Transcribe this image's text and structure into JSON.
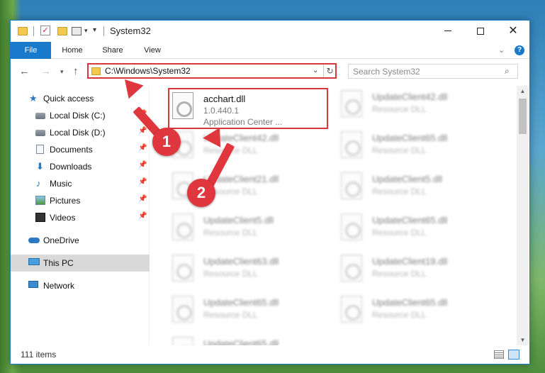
{
  "window": {
    "title": "System32",
    "controls": {
      "minimize": "",
      "maximize": "",
      "close": "✕"
    }
  },
  "ribbon": {
    "tabs": [
      "File",
      "Home",
      "Share",
      "View"
    ],
    "help": "?"
  },
  "navigation": {
    "address": "C:\\Windows\\System32",
    "search_placeholder": "Search System32"
  },
  "sidebar": {
    "items": [
      {
        "label": "Quick access",
        "icon": "star-icon",
        "pinned": false
      },
      {
        "label": "Local Disk (C:)",
        "icon": "disk-icon",
        "pinned": true
      },
      {
        "label": "Local Disk (D:)",
        "icon": "disk-icon",
        "pinned": true
      },
      {
        "label": "Documents",
        "icon": "documents-icon",
        "pinned": true
      },
      {
        "label": "Downloads",
        "icon": "downloads-icon",
        "pinned": true
      },
      {
        "label": "Music",
        "icon": "music-icon",
        "pinned": true
      },
      {
        "label": "Pictures",
        "icon": "pictures-icon",
        "pinned": true
      },
      {
        "label": "Videos",
        "icon": "videos-icon",
        "pinned": true
      },
      {
        "label": "OneDrive",
        "icon": "onedrive-icon",
        "pinned": false
      },
      {
        "label": "This PC",
        "icon": "this-pc-icon",
        "pinned": false,
        "selected": true
      },
      {
        "label": "Network",
        "icon": "network-icon",
        "pinned": false
      }
    ]
  },
  "files": {
    "highlighted": {
      "name": "acchart.dll",
      "version": "1.0.440.1",
      "description": "Application Center ..."
    },
    "blurred": [
      {
        "name": "UpdateClient42.dll",
        "type": "Resource DLL"
      },
      {
        "name": "UpdateClient65.dll",
        "type": "Resource DLL"
      },
      {
        "name": "UpdateClient42.dll",
        "type": "Resource DLL"
      },
      {
        "name": "UpdateClient65.dll",
        "type": "Resource DLL"
      },
      {
        "name": "UpdateClient21.dll",
        "type": "Resource DLL"
      },
      {
        "name": "UpdateClient5.dll",
        "type": "Resource DLL"
      },
      {
        "name": "UpdateClient5.dll",
        "type": "Resource DLL"
      },
      {
        "name": "UpdateClient65.dll",
        "type": "Resource DLL"
      },
      {
        "name": "UpdateClient63.dll",
        "type": "Resource DLL"
      },
      {
        "name": "UpdateClient19.dll",
        "type": "Resource DLL"
      },
      {
        "name": "UpdateClient65.dll",
        "type": "Resource DLL"
      },
      {
        "name": "UpdateClient65.dll",
        "type": "Resource DLL"
      }
    ]
  },
  "status": {
    "item_count": "111 items"
  },
  "annotations": {
    "step1": "1",
    "step2": "2"
  },
  "colors": {
    "accent": "#1979ca",
    "annotation": "#e0363e"
  }
}
